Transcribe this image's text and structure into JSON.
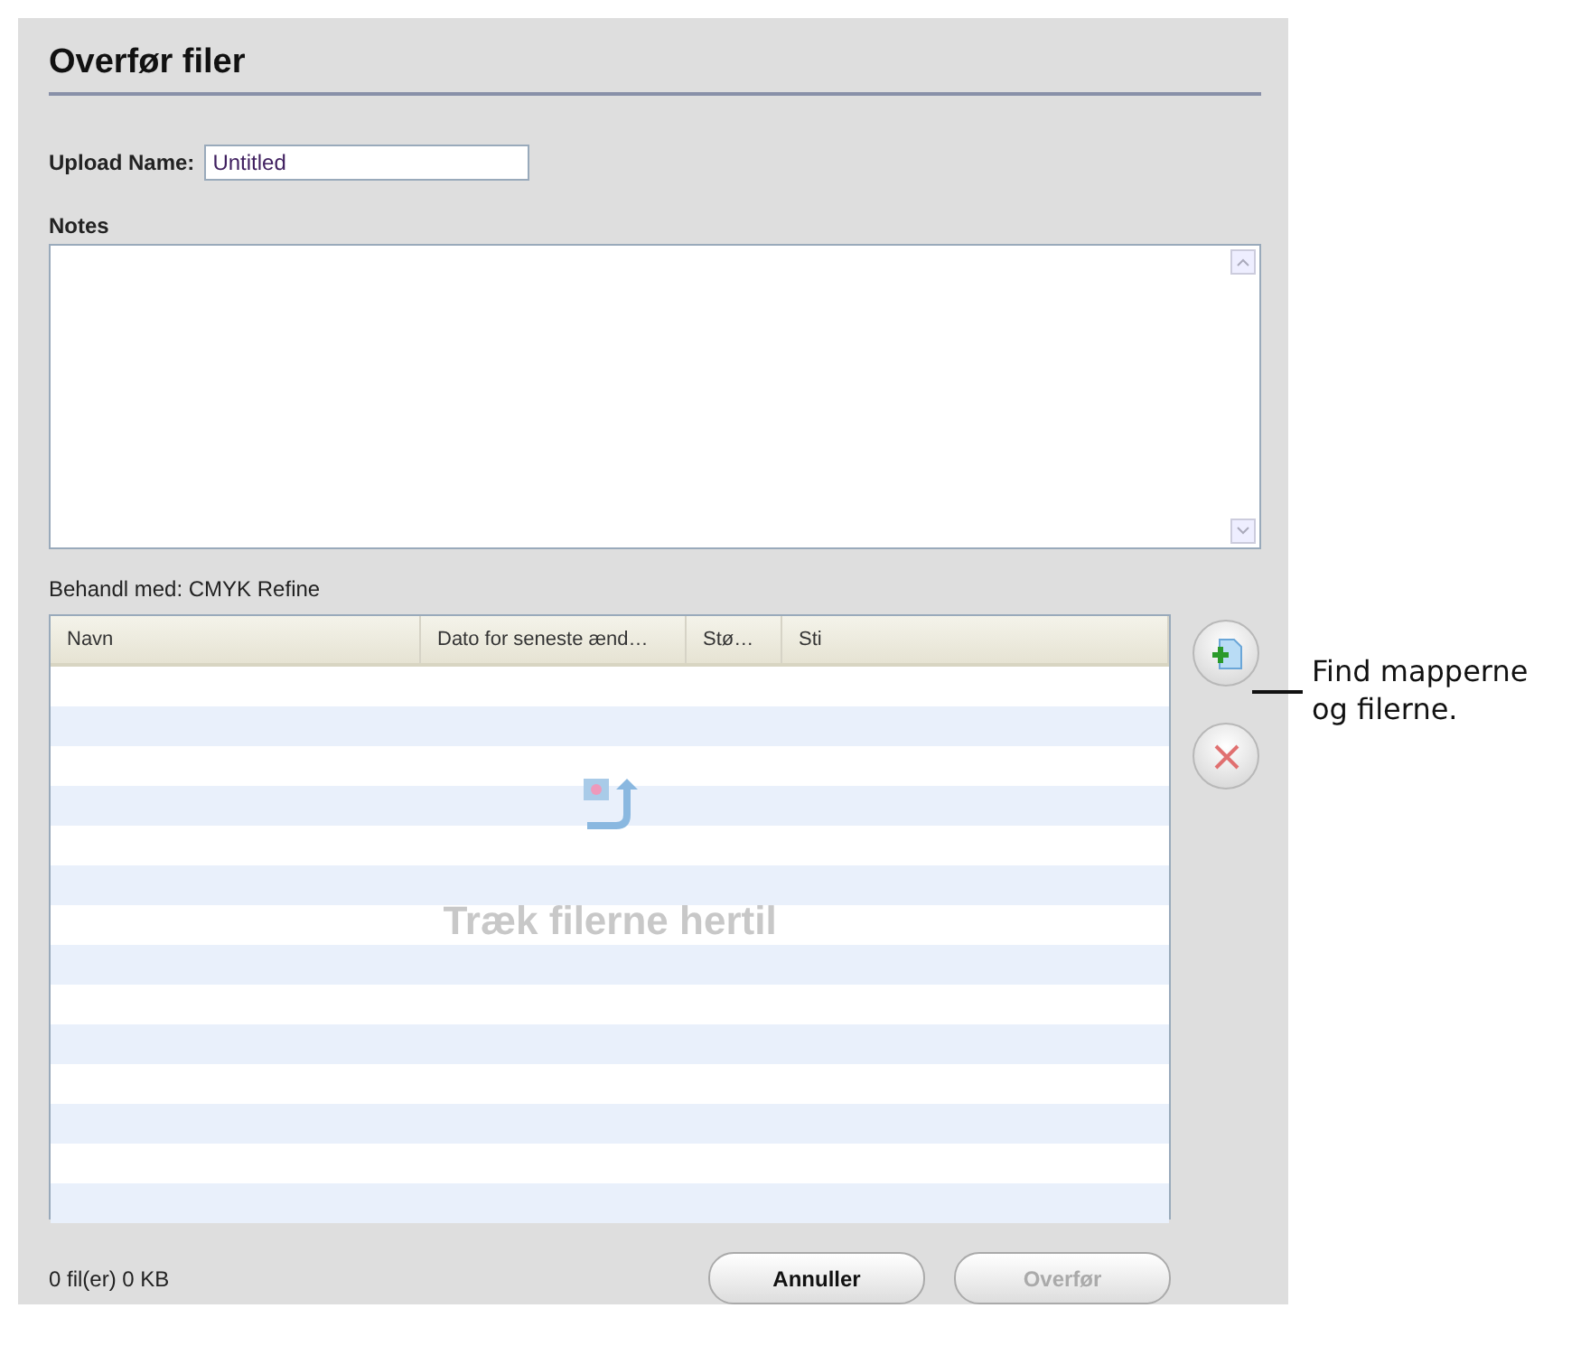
{
  "title": "Overfør filer",
  "upload_name": {
    "label": "Upload Name:",
    "value": "Untitled"
  },
  "notes": {
    "label": "Notes"
  },
  "process_with": "Behandl med: CMYK Refine",
  "table": {
    "columns": [
      "Navn",
      "Dato for seneste ænd…",
      "Stø…",
      "Sti"
    ],
    "drop_hint": "Træk filerne hertil"
  },
  "side_buttons": [
    {
      "kind": "add"
    },
    {
      "kind": "remove"
    }
  ],
  "status": "0 fil(er) 0 KB",
  "buttons": [
    {
      "label": "Annuller",
      "disabled": false
    },
    {
      "label": "Overfør",
      "disabled": true
    }
  ],
  "callout": "Find mapperne og filerne."
}
